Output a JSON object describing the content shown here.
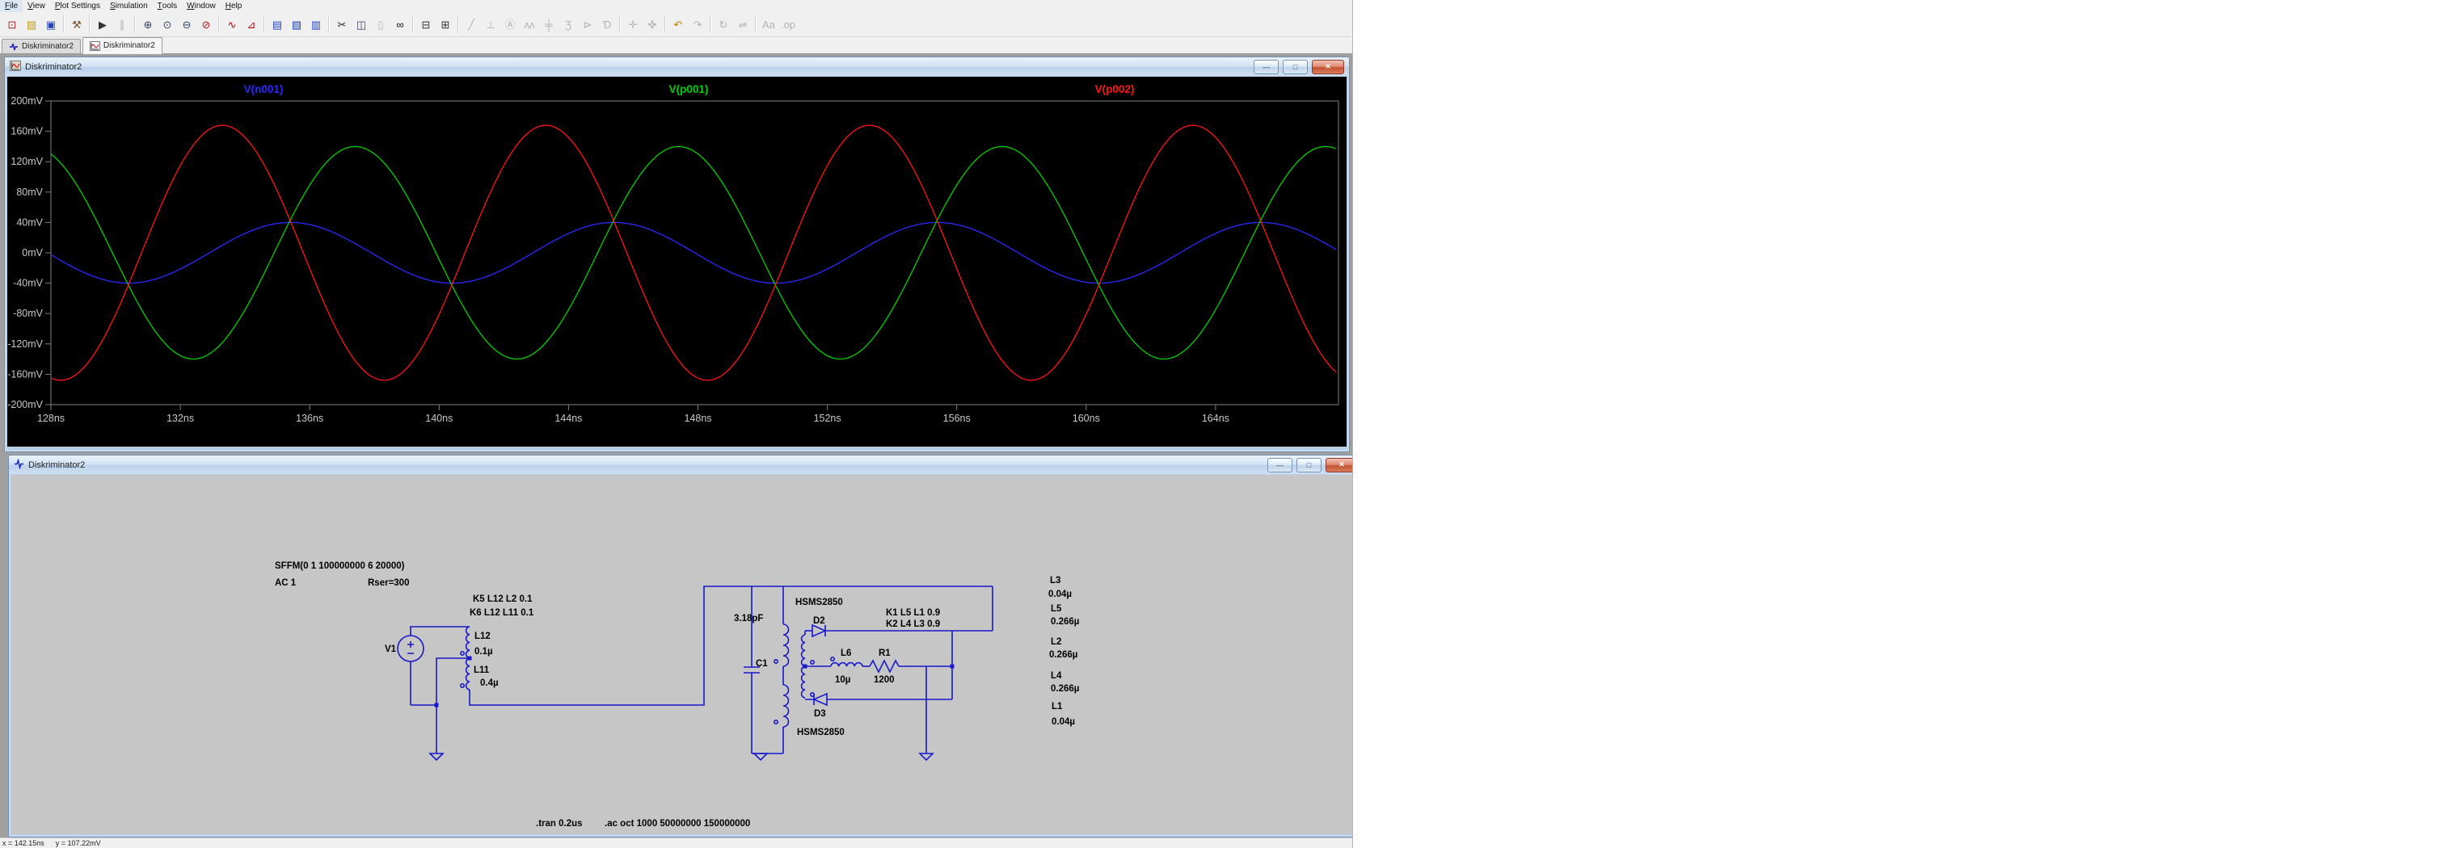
{
  "menu": {
    "items": [
      "File",
      "View",
      "Plot Settings",
      "Simulation",
      "Tools",
      "Window",
      "Help"
    ]
  },
  "toolbar": {
    "groups": [
      {
        "items": [
          {
            "name": "new-schematic-icon",
            "glyph": "⊡",
            "color": "#b02020",
            "disabled": false
          },
          {
            "name": "open-folder-icon",
            "glyph": "▨",
            "color": "#c8a020",
            "disabled": false
          },
          {
            "name": "save-icon",
            "glyph": "▣",
            "color": "#2244bb",
            "disabled": false
          }
        ]
      },
      {
        "items": [
          {
            "name": "control-panel-hammer-icon",
            "glyph": "⚒",
            "color": "#7a5230",
            "disabled": false
          }
        ]
      },
      {
        "items": [
          {
            "name": "run-icon",
            "glyph": "▶",
            "color": "#333333",
            "disabled": false
          },
          {
            "name": "pause-icon",
            "glyph": "∥",
            "color": "#888888",
            "disabled": true
          }
        ]
      },
      {
        "items": [
          {
            "name": "zoom-in-icon",
            "glyph": "⊕",
            "color": "#334466",
            "disabled": false
          },
          {
            "name": "zoom-extents-icon",
            "glyph": "⊙",
            "color": "#334466",
            "disabled": false
          },
          {
            "name": "zoom-out-icon",
            "glyph": "⊖",
            "color": "#334466",
            "disabled": false
          },
          {
            "name": "zoom-undo-icon",
            "glyph": "⊘",
            "color": "#bb1111",
            "disabled": false
          }
        ]
      },
      {
        "items": [
          {
            "name": "plot-settings-icon",
            "glyph": "∿",
            "color": "#c00000",
            "disabled": false
          },
          {
            "name": "mark-reference-icon",
            "glyph": "⊿",
            "color": "#c00000",
            "disabled": false
          }
        ]
      },
      {
        "items": [
          {
            "name": "tile-horizontal-icon",
            "glyph": "▤",
            "color": "#2244bb",
            "disabled": false
          },
          {
            "name": "cascade-windows-icon",
            "glyph": "▧",
            "color": "#2244bb",
            "disabled": false
          },
          {
            "name": "tile-vertical-icon",
            "glyph": "▥",
            "color": "#2244bb",
            "disabled": false
          }
        ]
      },
      {
        "items": [
          {
            "name": "cut-icon",
            "glyph": "✂",
            "color": "#222222",
            "disabled": false
          },
          {
            "name": "copy-icon",
            "glyph": "◫",
            "color": "#334466",
            "disabled": false
          },
          {
            "name": "paste-icon",
            "glyph": "▯",
            "color": "#888888",
            "disabled": true
          },
          {
            "name": "find-icon",
            "glyph": "∞",
            "color": "#111111",
            "disabled": false
          }
        ]
      },
      {
        "items": [
          {
            "name": "print-icon",
            "glyph": "⊟",
            "color": "#333333",
            "disabled": false
          },
          {
            "name": "print-preview-icon",
            "glyph": "⊞",
            "color": "#333333",
            "disabled": false
          }
        ]
      },
      {
        "items": [
          {
            "name": "wire-icon",
            "glyph": "╱",
            "color": "#888888",
            "disabled": true
          },
          {
            "name": "ground-icon",
            "glyph": "⊥",
            "color": "#888888",
            "disabled": true
          },
          {
            "name": "net-label-icon",
            "glyph": "Ⓐ",
            "color": "#888888",
            "disabled": true
          },
          {
            "name": "resistor-icon",
            "glyph": "ʌʌ",
            "color": "#888888",
            "disabled": true
          },
          {
            "name": "capacitor-icon",
            "glyph": "╪",
            "color": "#888888",
            "disabled": true
          },
          {
            "name": "inductor-icon",
            "glyph": "Ʒ",
            "color": "#888888",
            "disabled": true
          },
          {
            "name": "diode-icon",
            "glyph": "⊳",
            "color": "#888888",
            "disabled": true
          },
          {
            "name": "component-icon",
            "glyph": "Ɗ",
            "color": "#888888",
            "disabled": true
          }
        ]
      },
      {
        "items": [
          {
            "name": "move-icon",
            "glyph": "✛",
            "color": "#888888",
            "disabled": true
          },
          {
            "name": "drag-icon",
            "glyph": "✜",
            "color": "#888888",
            "disabled": true
          }
        ]
      },
      {
        "items": [
          {
            "name": "undo-icon",
            "glyph": "↶",
            "color": "#b8860b",
            "disabled": false
          },
          {
            "name": "redo-icon",
            "glyph": "↷",
            "color": "#888888",
            "disabled": true
          }
        ]
      },
      {
        "items": [
          {
            "name": "rotate-icon",
            "glyph": "↻",
            "color": "#888888",
            "disabled": true
          },
          {
            "name": "mirror-icon",
            "glyph": "⇌",
            "color": "#888888",
            "disabled": true
          }
        ]
      },
      {
        "items": [
          {
            "name": "text-icon",
            "glyph": "Aa",
            "color": "#888888",
            "disabled": true
          },
          {
            "name": "spice-directive-icon",
            "glyph": ".op",
            "color": "#888888",
            "disabled": true
          }
        ]
      }
    ]
  },
  "tabs": [
    {
      "label": "Diskriminator2",
      "icon": "schematic-tab-icon",
      "active": false
    },
    {
      "label": "Diskriminator2",
      "icon": "waveform-tab-icon",
      "active": true
    }
  ],
  "wave_window": {
    "title": "Diskriminator2",
    "buttons": {
      "minimize": "—",
      "restore": "□",
      "close": "✕"
    }
  },
  "chart_data": {
    "type": "line",
    "title": "",
    "background": "#000000",
    "frame_color": "#7f7f7f",
    "tick_label_color": "#c8c8c8",
    "grid": false,
    "legend_position": "top",
    "x_unit": "ns",
    "xlim_ns": [
      128,
      167.8
    ],
    "x_tick_step_ns": 4,
    "x_ticks": [
      "128ns",
      "132ns",
      "136ns",
      "140ns",
      "144ns",
      "148ns",
      "152ns",
      "156ns",
      "160ns",
      "164ns"
    ],
    "ylim_mV": [
      -200,
      200
    ],
    "y_tick_step_mV": 40,
    "y_ticks": [
      "200mV",
      "160mV",
      "120mV",
      "80mV",
      "40mV",
      "0mV",
      "-40mV",
      "-80mV",
      "-120mV",
      "-160mV",
      "-200mV"
    ],
    "series": [
      {
        "name": "V(n001)",
        "color": "#2a2aff",
        "waveform": "sine",
        "amplitude_mV": 40,
        "period_ns": 10,
        "peak_at_ns": 135.4
      },
      {
        "name": "V(p001)",
        "color": "#00d200",
        "waveform": "sine",
        "amplitude_mV": 140,
        "period_ns": 10,
        "peak_at_ns": 137.4
      },
      {
        "name": "V(p002)",
        "color": "#ff1414",
        "waveform": "sine",
        "amplitude_mV": 168,
        "period_ns": 10,
        "peak_at_ns": 133.3
      }
    ]
  },
  "schematic_window": {
    "title": "Diskriminator2",
    "buttons": {
      "minimize": "—",
      "restore": "□",
      "close": "✕"
    },
    "labels": {
      "sffm": "SFFM(0 1 100000000 6 20000)",
      "ac": "AC 1",
      "rser": "Rser=300",
      "k5": "K5 L12 L2 0.1",
      "k6": "K6 L12 L11 0.1",
      "v1": "V1",
      "l12": "L12",
      "l12_value": "0.1µ",
      "l11": "L11",
      "l11_value": "0.4µ",
      "c1": "C1",
      "c1_value": "3.18pF",
      "hsms_top": "HSMS2850",
      "hsms_bottom": "HSMS2850",
      "d2": "D2",
      "d3": "D3",
      "k1": "K1 L5 L1 0.9",
      "k2": "K2 L4 L3 0.9",
      "l6": "L6",
      "l6_value": "10µ",
      "r1": "R1",
      "r1_value": "1200",
      "tran_directive": ".tran 0.2us",
      "ac_directive": ".ac oct 1000 50000000 150000000",
      "inductor_list": [
        {
          "name": "L3",
          "value": "0.04µ"
        },
        {
          "name": "L5",
          "value": "0.266µ"
        },
        {
          "name": "L2",
          "value": "0.266µ"
        },
        {
          "name": "L4",
          "value": "0.266µ"
        },
        {
          "name": "L1",
          "value": "0.04µ"
        }
      ]
    }
  },
  "status_bar": {
    "x_readout": "x = 142.15ns",
    "y_readout": "y = 107.22mV"
  }
}
